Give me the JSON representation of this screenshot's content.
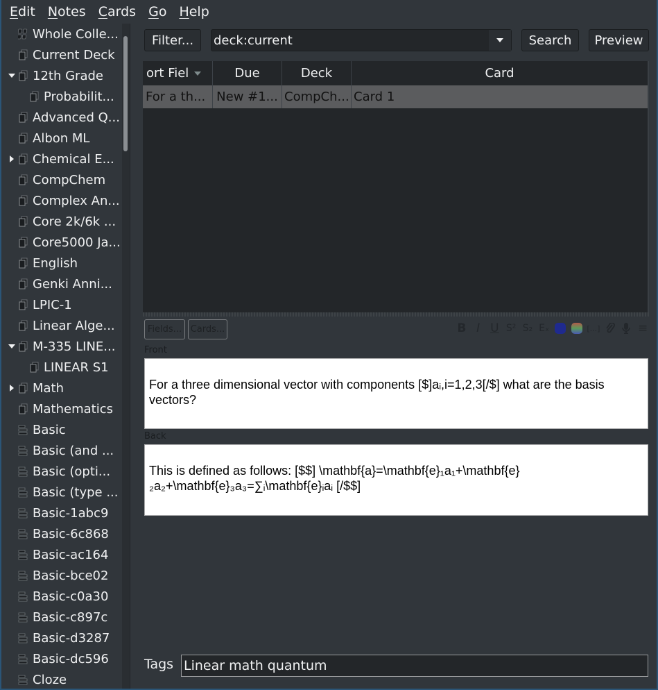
{
  "menu": {
    "items": [
      {
        "label": "Edit",
        "mnemonic": "E",
        "rest": "dit"
      },
      {
        "label": "Notes",
        "mnemonic": "N",
        "rest": "otes"
      },
      {
        "label": "Cards",
        "mnemonic": "C",
        "rest": "ards"
      },
      {
        "label": "Go",
        "mnemonic": "G",
        "rest": "o"
      },
      {
        "label": "Help",
        "mnemonic": "H",
        "rest": "elp"
      }
    ]
  },
  "sidebar": {
    "items": [
      {
        "label": "Whole Colle...",
        "icon": "collection-icon",
        "depth": 0,
        "expander": "none"
      },
      {
        "label": "Current Deck",
        "icon": "deck-icon",
        "depth": 0,
        "expander": "none"
      },
      {
        "label": "12th Grade",
        "icon": "deck-icon",
        "depth": 0,
        "expander": "expanded"
      },
      {
        "label": "Probabilit...",
        "icon": "deck-icon",
        "depth": 1,
        "expander": "none"
      },
      {
        "label": "Advanced Q...",
        "icon": "deck-icon",
        "depth": 0,
        "expander": "none"
      },
      {
        "label": "Albon ML",
        "icon": "deck-icon",
        "depth": 0,
        "expander": "none"
      },
      {
        "label": "Chemical E...",
        "icon": "deck-icon",
        "depth": 0,
        "expander": "collapsed"
      },
      {
        "label": "CompChem",
        "icon": "deck-icon",
        "depth": 0,
        "expander": "none"
      },
      {
        "label": "Complex An...",
        "icon": "deck-icon",
        "depth": 0,
        "expander": "none"
      },
      {
        "label": "Core 2k/6k ...",
        "icon": "deck-icon",
        "depth": 0,
        "expander": "none"
      },
      {
        "label": "Core5000 Ja...",
        "icon": "deck-icon",
        "depth": 0,
        "expander": "none"
      },
      {
        "label": "English",
        "icon": "deck-icon",
        "depth": 0,
        "expander": "none"
      },
      {
        "label": "Genki Anni...",
        "icon": "deck-icon",
        "depth": 0,
        "expander": "none"
      },
      {
        "label": "LPIC-1",
        "icon": "deck-icon",
        "depth": 0,
        "expander": "none"
      },
      {
        "label": "Linear Alge...",
        "icon": "deck-icon",
        "depth": 0,
        "expander": "none"
      },
      {
        "label": "M-335 LINE...",
        "icon": "deck-icon",
        "depth": 0,
        "expander": "expanded"
      },
      {
        "label": "LINEAR S1",
        "icon": "deck-icon",
        "depth": 1,
        "expander": "none"
      },
      {
        "label": "Math",
        "icon": "deck-icon",
        "depth": 0,
        "expander": "collapsed"
      },
      {
        "label": "Mathematics",
        "icon": "deck-icon",
        "depth": 0,
        "expander": "none"
      },
      {
        "label": "Basic",
        "icon": "note-type-icon",
        "depth": 0,
        "expander": "none"
      },
      {
        "label": "Basic (and ...",
        "icon": "note-type-icon",
        "depth": 0,
        "expander": "none"
      },
      {
        "label": "Basic (opti...",
        "icon": "note-type-icon",
        "depth": 0,
        "expander": "none"
      },
      {
        "label": "Basic (type ...",
        "icon": "note-type-icon",
        "depth": 0,
        "expander": "none"
      },
      {
        "label": "Basic-1abc9",
        "icon": "note-type-icon",
        "depth": 0,
        "expander": "none"
      },
      {
        "label": "Basic-6c868",
        "icon": "note-type-icon",
        "depth": 0,
        "expander": "none"
      },
      {
        "label": "Basic-ac164",
        "icon": "note-type-icon",
        "depth": 0,
        "expander": "none"
      },
      {
        "label": "Basic-bce02",
        "icon": "note-type-icon",
        "depth": 0,
        "expander": "none"
      },
      {
        "label": "Basic-c0a30",
        "icon": "note-type-icon",
        "depth": 0,
        "expander": "none"
      },
      {
        "label": "Basic-c897c",
        "icon": "note-type-icon",
        "depth": 0,
        "expander": "none"
      },
      {
        "label": "Basic-d3287",
        "icon": "note-type-icon",
        "depth": 0,
        "expander": "none"
      },
      {
        "label": "Basic-dc596",
        "icon": "note-type-icon",
        "depth": 0,
        "expander": "none"
      },
      {
        "label": "Cloze",
        "icon": "note-type-icon",
        "depth": 0,
        "expander": "none"
      }
    ]
  },
  "toolbar": {
    "filter_label": "Filter...",
    "search_value": "deck:current",
    "search_label": "Search",
    "preview_label": "Preview"
  },
  "table": {
    "columns": [
      "ort Fiel",
      "Due",
      "Deck",
      "Card"
    ],
    "sort_column": 0,
    "rows": [
      {
        "sort_field": "For a th...",
        "due": "New #1...",
        "deck": "CompCh...",
        "card": "Card 1",
        "selected": true
      }
    ]
  },
  "editor": {
    "fields_button": "Fields...",
    "cards_button": "Cards...",
    "format_buttons": [
      {
        "name": "bold-icon",
        "glyph": "B"
      },
      {
        "name": "italic-icon",
        "glyph": "I"
      },
      {
        "name": "underline-icon",
        "glyph": "U"
      },
      {
        "name": "superscript-icon",
        "glyph": "S²"
      },
      {
        "name": "subscript-icon",
        "glyph": "S₂"
      },
      {
        "name": "clear-format-icon",
        "glyph": "Eₓ"
      },
      {
        "name": "text-color-icon",
        "glyph": ""
      },
      {
        "name": "highlight-color-icon",
        "glyph": ""
      },
      {
        "name": "cloze-icon",
        "glyph": "[...]"
      },
      {
        "name": "attach-icon",
        "glyph": "⌀"
      },
      {
        "name": "record-audio-icon",
        "glyph": "🎙"
      },
      {
        "name": "more-menu-icon",
        "glyph": "≡"
      }
    ],
    "colors": {
      "text_color": "#1f2a8f",
      "highlight_gradient": [
        "#b35a4a",
        "#5a9a5a",
        "#4a5ab3"
      ]
    },
    "front_label": "Front",
    "front_text": "For a three dimensional vector with components [$]aᵢ,i=1,2,3[/$] what are the basis vectors?",
    "back_label": "Back",
    "back_text": "This is defined as follows: [$$] \\mathbf{a}=\\mathbf{e}₁a₁+\\mathbf{e}₂a₂+\\mathbf{e}₃a₃=∑ᵢ\\mathbf{e}ᵢaᵢ [/$$]",
    "tags_label": "Tags",
    "tags_value": "Linear math quantum"
  }
}
